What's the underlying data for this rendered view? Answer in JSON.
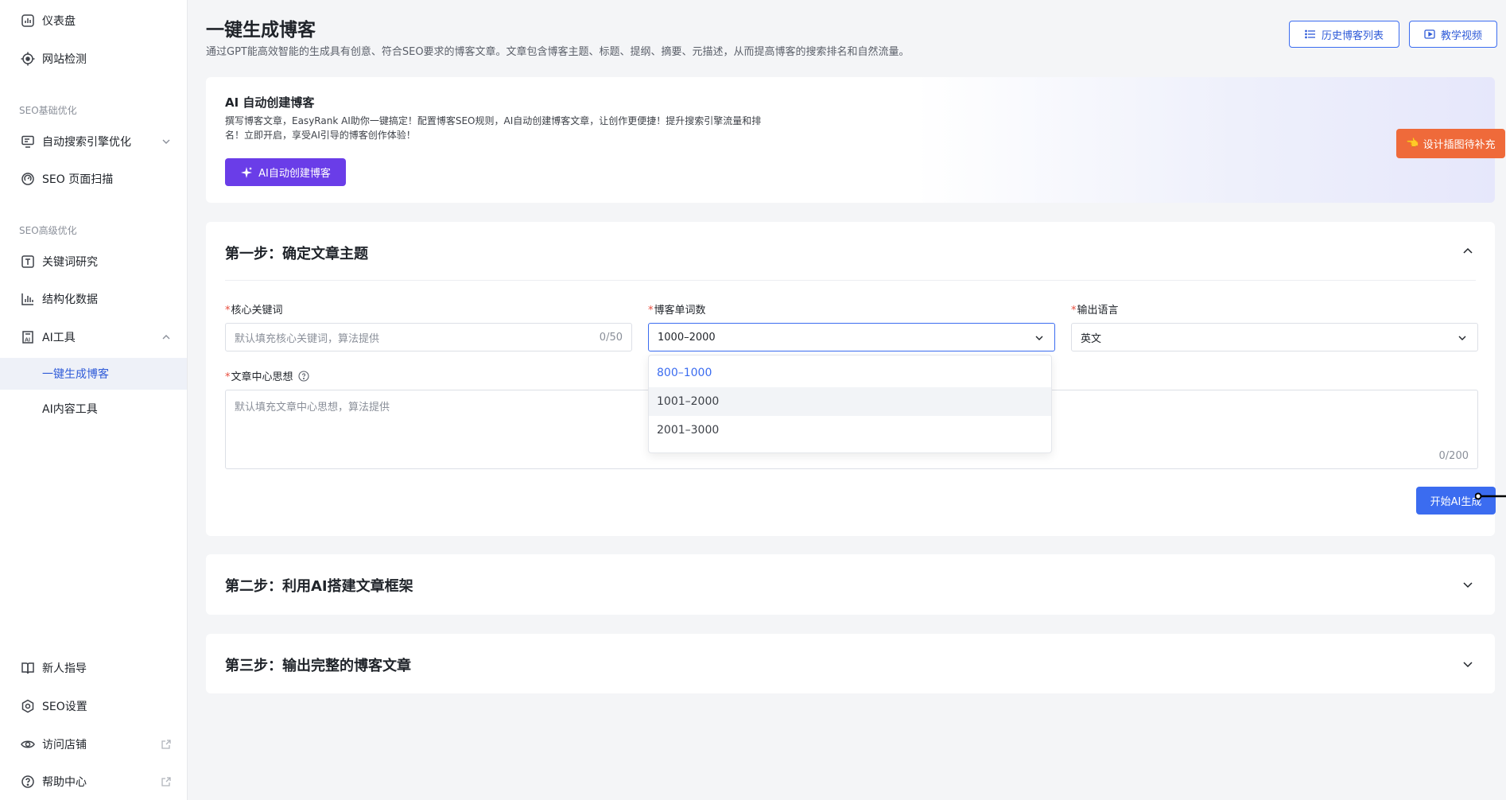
{
  "sidebar": {
    "items_top": [
      {
        "label": "仪表盘",
        "icon": "dashboard-icon"
      },
      {
        "label": "网站检测",
        "icon": "target-icon"
      }
    ],
    "section_basic": "SEO基础优化",
    "items_basic": [
      {
        "label": "自动搜索引擎优化",
        "icon": "monitor-icon"
      },
      {
        "label": "SEO 页面扫描",
        "icon": "scan-icon"
      }
    ],
    "section_advanced": "SEO高级优化",
    "items_advanced": [
      {
        "label": "关键词研究",
        "icon": "text-box-icon"
      },
      {
        "label": "结构化数据",
        "icon": "bar-chart-icon"
      },
      {
        "label": "AI工具",
        "icon": "ai-doc-icon"
      }
    ],
    "ai_sub": [
      {
        "label": "一键生成博客"
      },
      {
        "label": "AI内容工具"
      }
    ],
    "items_bottom": [
      {
        "label": "新人指导",
        "icon": "book-icon"
      },
      {
        "label": "SEO设置",
        "icon": "hex-gear-icon"
      },
      {
        "label": "访问店铺",
        "icon": "eye-icon"
      },
      {
        "label": "帮助中心",
        "icon": "help-icon"
      }
    ]
  },
  "header": {
    "title": "一键生成博客",
    "description": "通过GPT能高效智能的生成具有创意、符合SEO要求的博客文章。文章包含博客主题、标题、提纲、摘要、元描述，从而提高博客的搜索排名和自然流量。",
    "history_button": "历史博客列表",
    "tutorial_button": "教学视频"
  },
  "hero": {
    "title": "AI 自动创建博客",
    "description": "撰写博客文章，EasyRank AI助你一键搞定！配置博客SEO规则，AI自动创建博客文章，让创作更便捷！提升搜索引擎流量和排名！立即开启，享受AI引导的博客创作体验！",
    "button": "AI自动创建博客",
    "badge": "设计插图待补充"
  },
  "step1": {
    "title": "第一步：确定文章主题",
    "keyword": {
      "label": "核心关键词",
      "placeholder": "默认填充核心关键词，算法提供",
      "count": "0/50"
    },
    "wordcount": {
      "label": "博客单词数",
      "value": "1000–2000",
      "options": [
        "800–1000",
        "1001–2000",
        "2001–3000"
      ]
    },
    "language": {
      "label": "输出语言",
      "value": "英文"
    },
    "theme": {
      "label": "文章中心思想",
      "placeholder": "默认填充文章中心思想，算法提供",
      "count": "0/200"
    },
    "submit": "开始AI生成"
  },
  "step2": {
    "title": "第二步：利用AI搭建文章框架"
  },
  "step3": {
    "title": "第三步：输出完整的博客文章"
  },
  "colors": {
    "accent": "#3b6cf0",
    "purple": "#6a3de8",
    "orange": "#ef6a3a",
    "required": "#e84b3c"
  }
}
